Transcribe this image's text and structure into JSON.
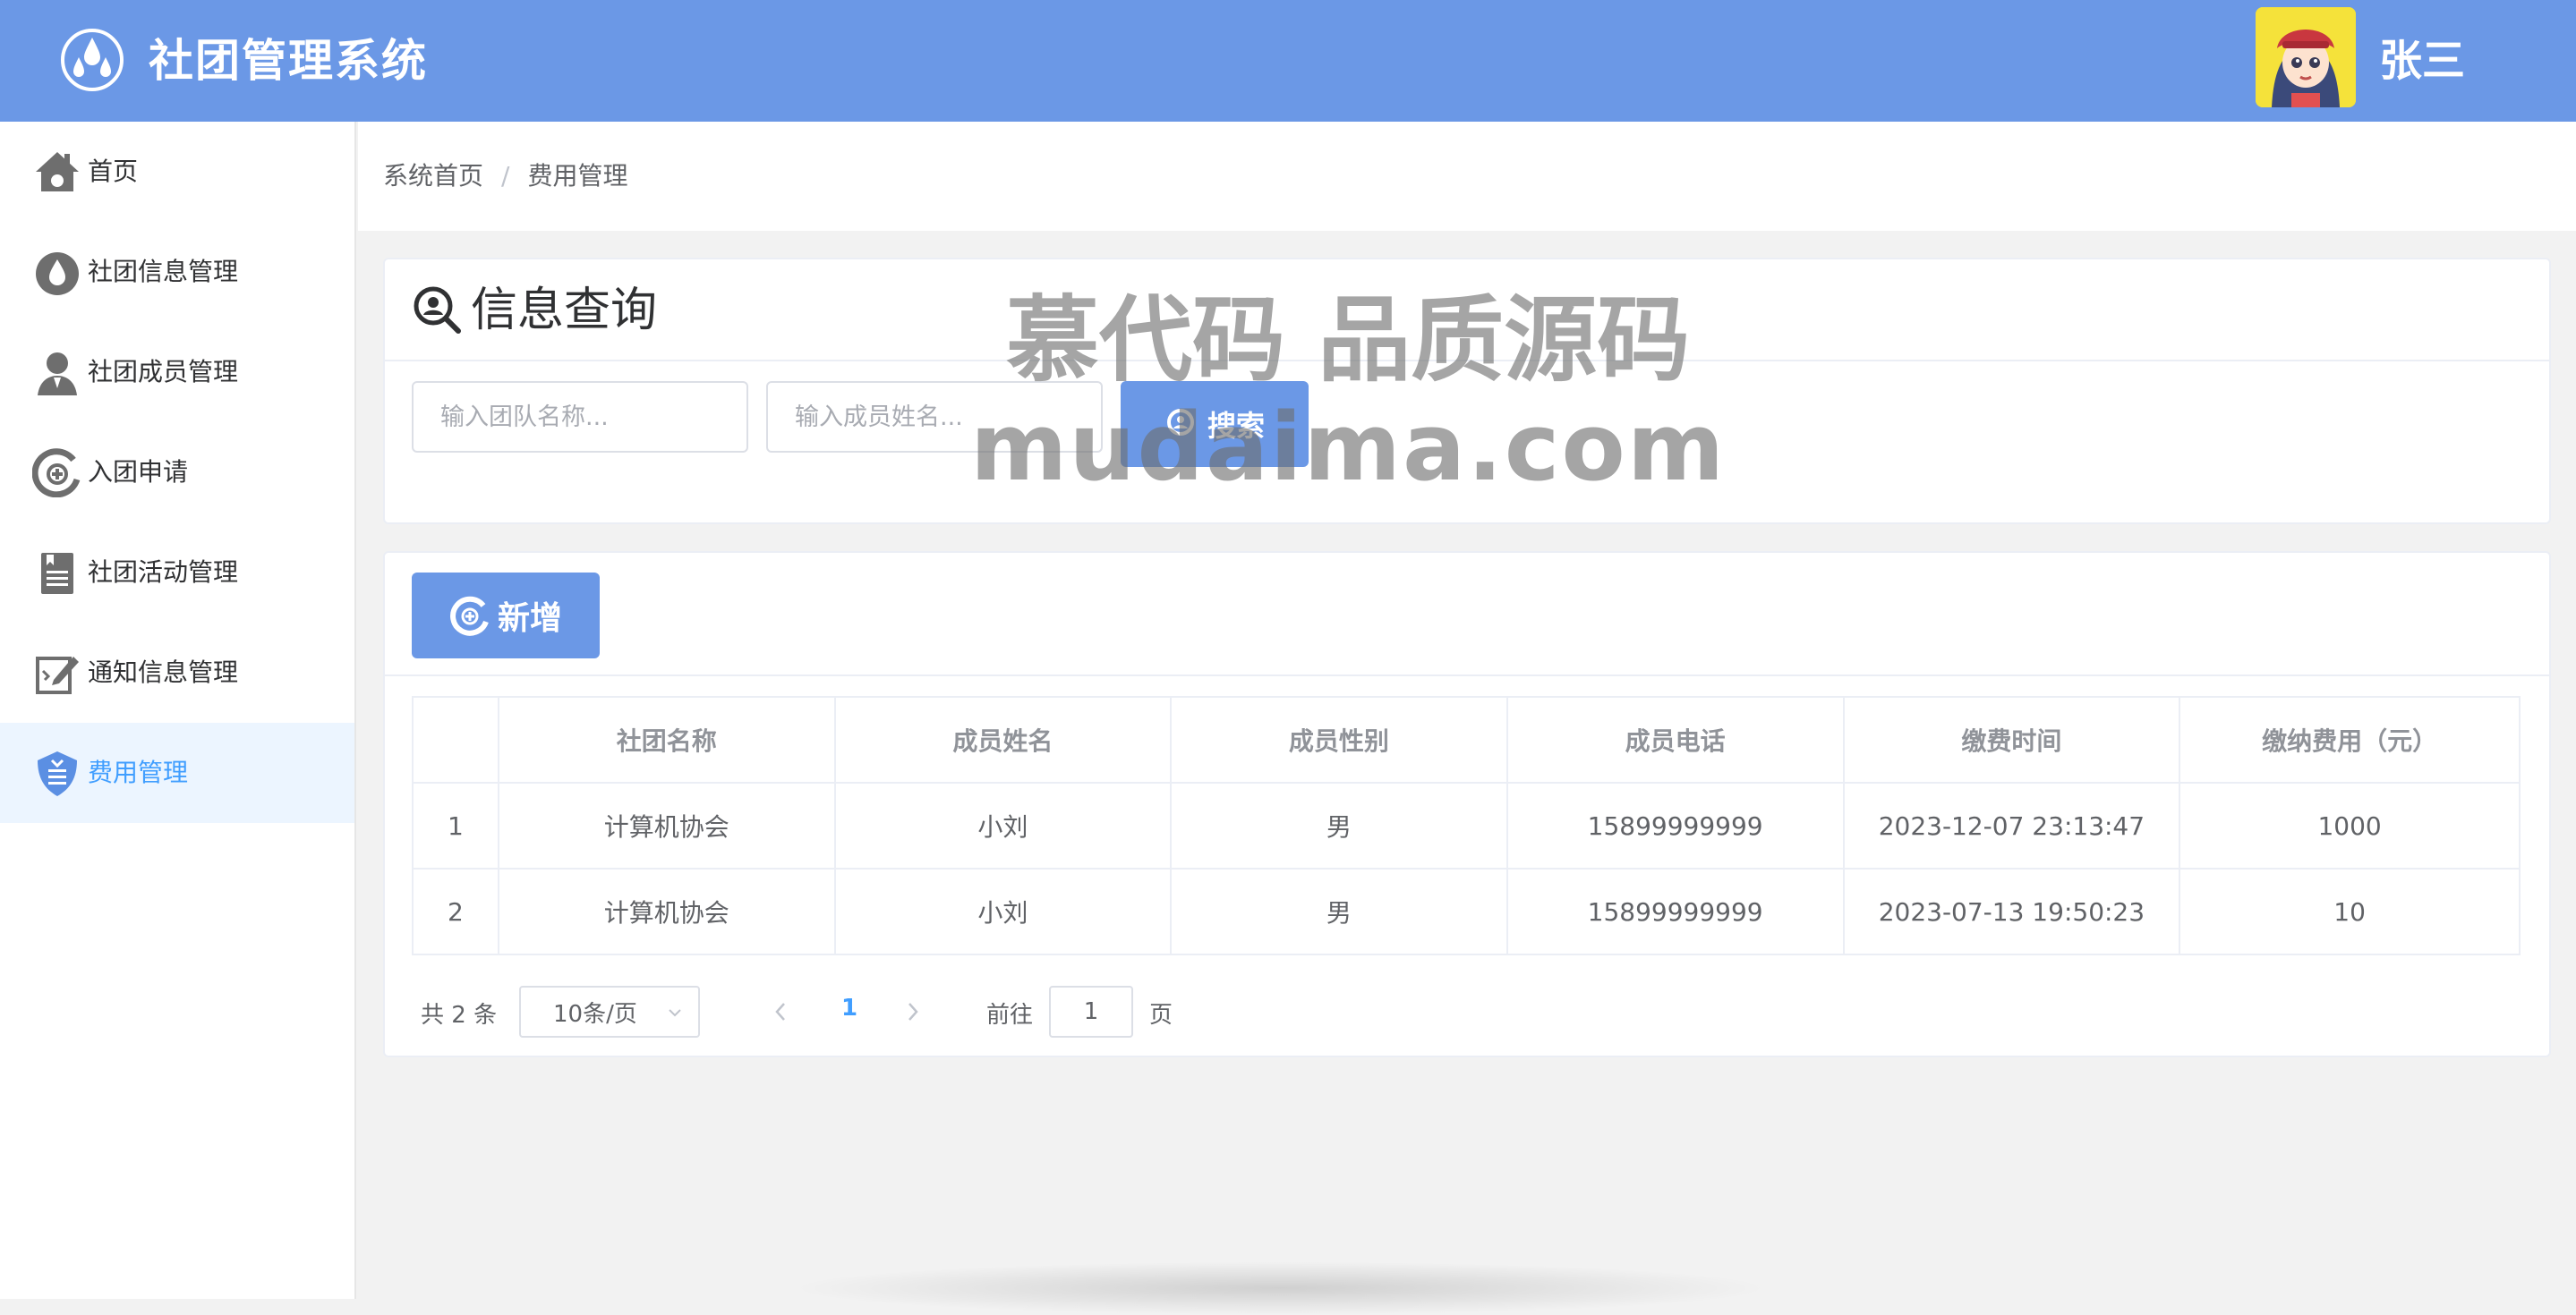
{
  "header": {
    "app_title": "社团管理系统",
    "user_name": "张三",
    "logo_icon": "water-drops-icon",
    "avatar": "avatar"
  },
  "sidebar": {
    "items": [
      {
        "label": "首页",
        "icon": "home-icon",
        "active": false
      },
      {
        "label": "社团信息管理",
        "icon": "drop-icon",
        "active": false
      },
      {
        "label": "社团成员管理",
        "icon": "user-icon",
        "active": false
      },
      {
        "label": "入团申请",
        "icon": "add-circle-icon",
        "active": false
      },
      {
        "label": "社团活动管理",
        "icon": "document-list-icon",
        "active": false
      },
      {
        "label": "通知信息管理",
        "icon": "edit-document-icon",
        "active": false
      },
      {
        "label": "费用管理",
        "icon": "shield-icon",
        "active": true
      }
    ],
    "active_color": "#409eff"
  },
  "breadcrumb": {
    "home": "系统首页",
    "separator": "/",
    "current": "费用管理"
  },
  "query": {
    "title": "信息查询",
    "team_placeholder": "输入团队名称...",
    "member_placeholder": "输入成员姓名...",
    "team_value": "",
    "member_value": "",
    "search_label": "搜索"
  },
  "toolbar": {
    "add_label": "新增"
  },
  "table": {
    "columns": [
      "",
      "社团名称",
      "成员姓名",
      "成员性别",
      "成员电话",
      "缴费时间",
      "缴纳费用（元）"
    ],
    "rows": [
      [
        "1",
        "计算机协会",
        "小刘",
        "男",
        "15899999999",
        "2023-12-07 23:13:47",
        "1000"
      ],
      [
        "2",
        "计算机协会",
        "小刘",
        "男",
        "15899999999",
        "2023-07-13 19:50:23",
        "10"
      ]
    ]
  },
  "pager": {
    "total": "共 2 条",
    "page_size": "10条/页",
    "current_page": "1",
    "goto_label": "前往",
    "goto_value": "1",
    "page_unit": "页"
  },
  "watermark": {
    "line1": "慕代码 品质源码",
    "line2": "mudaima.com"
  },
  "colors": {
    "header_bg": "#6b98e6",
    "primary": "#409eff",
    "button_bg": "#6b98e6"
  }
}
